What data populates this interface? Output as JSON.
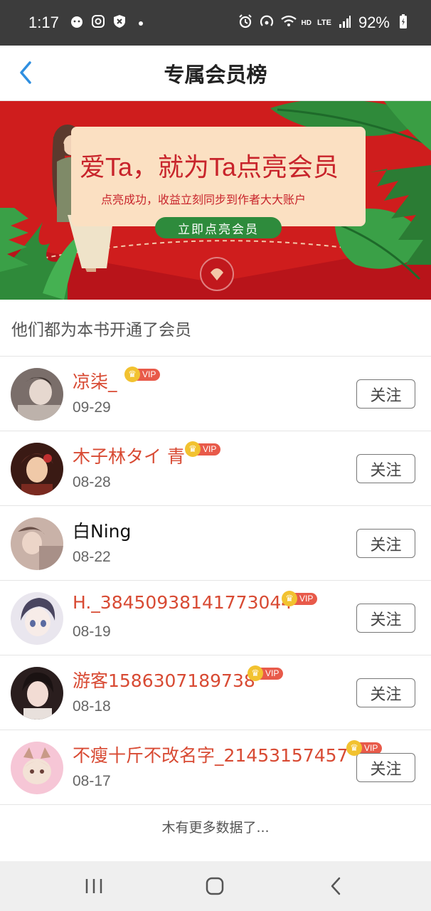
{
  "status_bar": {
    "time": "1:17",
    "battery": "92%",
    "icons": [
      "notification-icon",
      "instagram-icon",
      "shield-icon",
      "dot-icon",
      "alarm-icon",
      "hotspot-icon",
      "wifi-icon",
      "hd-icon",
      "lte-icon",
      "signal-icon",
      "battery-icon"
    ],
    "hd_label": "HD",
    "lte_label": "LTE"
  },
  "header": {
    "title": "专属会员榜",
    "back_icon": "chevron-left-icon"
  },
  "banner": {
    "headline": "爱Ta，就为Ta点亮会员",
    "subline": "点亮成功，收益立刻同步到作者大大账户",
    "cta": "立即点亮会员",
    "colors": {
      "background": "#cf1d1d",
      "card": "#fbe0c2",
      "cta": "#2e8b3c"
    }
  },
  "section": {
    "title": "他们都为本书开通了会员"
  },
  "members": [
    {
      "name": "凉柒_",
      "date": "09-29",
      "vip": true,
      "follow_label": "关注",
      "avatar_color": "#7a6e6a"
    },
    {
      "name": "木子林タイ 青",
      "date": "08-28",
      "vip": true,
      "follow_label": "关注",
      "avatar_color": "#5a2b22"
    },
    {
      "name": "白Ning",
      "date": "08-22",
      "vip": false,
      "follow_label": "关注",
      "avatar_color": "#c9b2a8"
    },
    {
      "name": "H._38450938141773044",
      "date": "08-19",
      "vip": true,
      "follow_label": "关注",
      "avatar_color": "#d8d4de"
    },
    {
      "name": "游客1586307189738",
      "date": "08-18",
      "vip": true,
      "follow_label": "关注",
      "avatar_color": "#3a2a2a"
    },
    {
      "name": "不瘦十斤不改名字_21453157457",
      "date": "08-17",
      "vip": true,
      "follow_label": "关注",
      "avatar_color": "#f6c6d6"
    }
  ],
  "vip_label": "VIP",
  "footer_text": "木有更多数据了...",
  "nav_bar": {
    "icons": [
      "recent-apps-icon",
      "home-icon",
      "back-icon"
    ]
  },
  "colors": {
    "vip_name": "#d84a33",
    "accent_blue": "#2f8fe0"
  }
}
